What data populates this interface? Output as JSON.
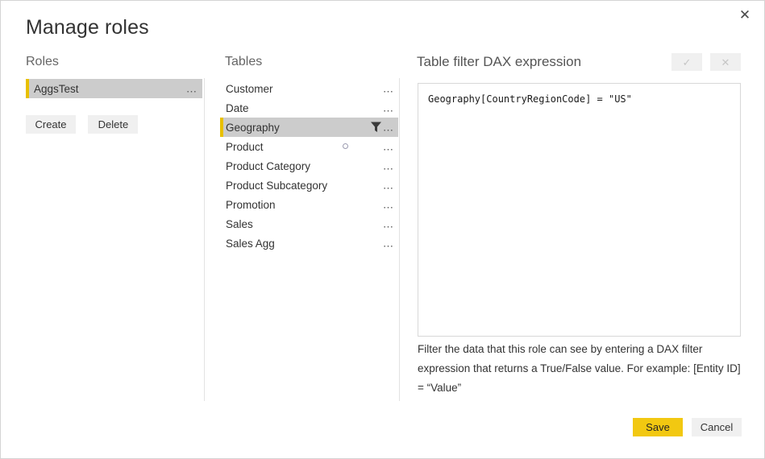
{
  "dialog": {
    "title": "Manage roles",
    "close_label": "✕"
  },
  "roles": {
    "header": "Roles",
    "items": [
      {
        "label": "AggsTest",
        "selected": true,
        "menu": "⋯"
      }
    ],
    "create_label": "Create",
    "delete_label": "Delete"
  },
  "tables": {
    "header": "Tables",
    "items": [
      {
        "label": "Customer",
        "selected": false,
        "filtered": false,
        "busy": false,
        "menu": "⋯"
      },
      {
        "label": "Date",
        "selected": false,
        "filtered": false,
        "busy": false,
        "menu": "⋯"
      },
      {
        "label": "Geography",
        "selected": true,
        "filtered": true,
        "busy": false,
        "menu": "⋯"
      },
      {
        "label": "Product",
        "selected": false,
        "filtered": false,
        "busy": true,
        "menu": "⋯"
      },
      {
        "label": "Product Category",
        "selected": false,
        "filtered": false,
        "busy": false,
        "menu": "⋯"
      },
      {
        "label": "Product Subcategory",
        "selected": false,
        "filtered": false,
        "busy": false,
        "menu": "⋯"
      },
      {
        "label": "Promotion",
        "selected": false,
        "filtered": false,
        "busy": false,
        "menu": "⋯"
      },
      {
        "label": "Sales",
        "selected": false,
        "filtered": false,
        "busy": false,
        "menu": "⋯"
      },
      {
        "label": "Sales Agg",
        "selected": false,
        "filtered": false,
        "busy": false,
        "menu": "⋯"
      }
    ]
  },
  "dax": {
    "header": "Table filter DAX expression",
    "accept_label": "✓",
    "cancel_label": "✕",
    "expression": "Geography[CountryRegionCode] = \"US\"",
    "help_text": "Filter the data that this role can see by entering a DAX filter expression that returns a True/False value. For example: [Entity ID] = “Value”"
  },
  "footer": {
    "save_label": "Save",
    "cancel_label": "Cancel"
  },
  "colors": {
    "accent_yellow": "#e8c000",
    "save_yellow": "#f2c811",
    "selection_gray": "#cccccc",
    "button_gray": "#f0f0f0",
    "divider_gray": "#e2e2e2"
  }
}
